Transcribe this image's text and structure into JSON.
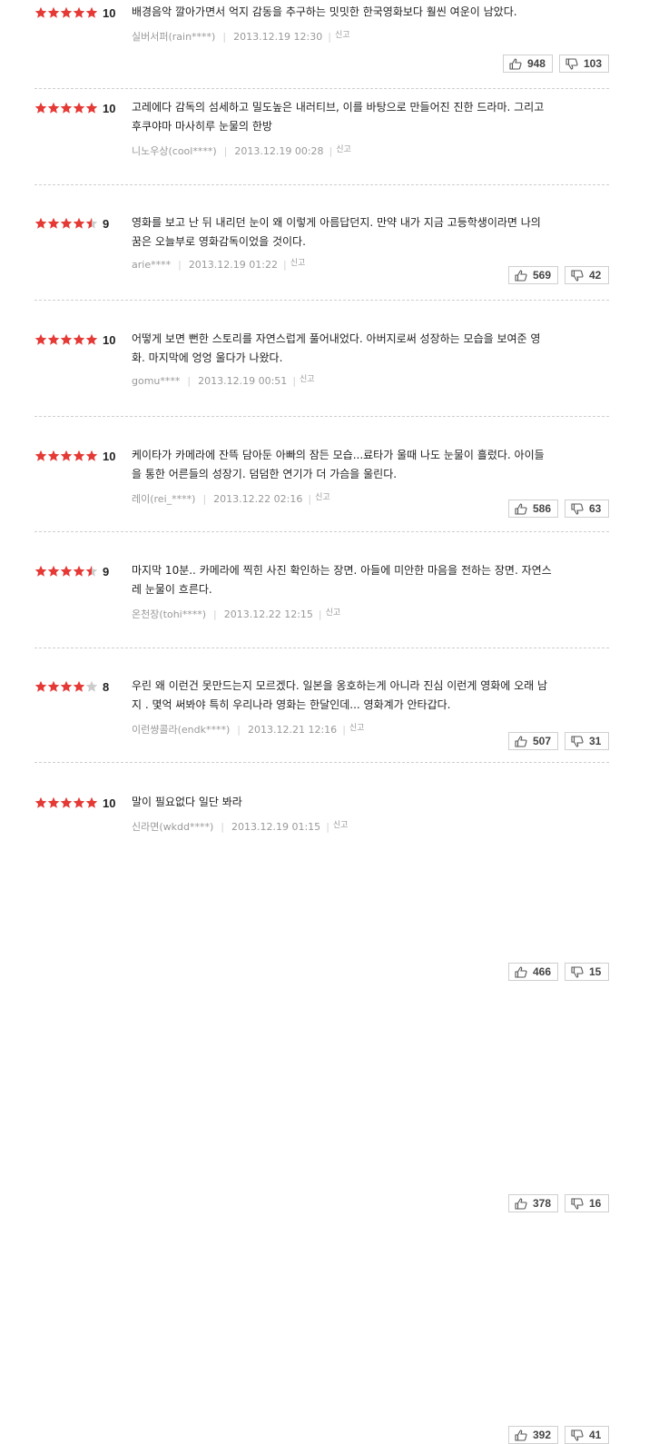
{
  "reviews": [
    {
      "stars": 5,
      "score": "10",
      "lines": [
        "배경음악 깔아가면서 억지 감동을 추구하는 밋밋한 한국영화보다 훨씬 여운이 남았다."
      ],
      "user": "실버서퍼(rain****)",
      "date": "2013.12.19 12:30",
      "report": "신고",
      "likes": "948",
      "dislikes": "103"
    },
    {
      "stars": 5,
      "score": "10",
      "lines": [
        "고레에다 감독의 섬세하고 밀도높은 내러티브, 이를 바탕으로 만들어진 진한 드라마. 그리고",
        "후쿠야마 마사히루 눈물의 한방"
      ],
      "user": "니노우상(cool****)",
      "date": "2013.12.19 00:28",
      "report": "신고",
      "likes": "569",
      "dislikes": "42"
    },
    {
      "stars": 4.5,
      "score": "9",
      "lines": [
        "영화를 보고 난 뒤 내리던 눈이 왜 이렇게 아름답던지. 만약 내가 지금 고등학생이라면 나의",
        "꿈은 오늘부로 영화감독이었을 것이다."
      ],
      "user": "arie****",
      "date": "2013.12.19 01:22",
      "report": "신고",
      "likes": "586",
      "dislikes": "63"
    },
    {
      "stars": 5,
      "score": "10",
      "lines": [
        "어떻게 보면 뻔한 스토리를 자연스럽게 풀어내었다. 아버지로써 성장하는 모습을 보여준 영",
        "화. 마지막에 엉엉 울다가 나왔다."
      ],
      "user": "gomu****",
      "date": "2013.12.19 00:51",
      "report": "신고",
      "likes": "507",
      "dislikes": "31"
    },
    {
      "stars": 5,
      "score": "10",
      "lines": [
        "케이타가 카메라에 잔뜩 담아둔 아빠의 잠든 모습...료타가 울때 나도 눈물이 흘렀다. 아이들",
        "을 통한 어른들의 성장기. 덤덤한 연기가 더 가슴을 울린다."
      ],
      "user": "레이(rei_****)",
      "date": "2013.12.22 02:16",
      "report": "신고",
      "likes": "466",
      "dislikes": "15"
    },
    {
      "stars": 4.5,
      "score": "9",
      "lines": [
        "마지막 10분.. 카메라에 찍힌 사진 확인하는 장면. 아들에 미안한 마음을 전하는 장면. 자연스",
        "레 눈물이 흐른다."
      ],
      "user": "온천장(tohi****)",
      "date": "2013.12.22 12:15",
      "report": "신고",
      "likes": "378",
      "dislikes": "16"
    },
    {
      "stars": 4,
      "score": "8",
      "lines": [
        "우린 왜 이런건 못만드는지 모르겠다. 일본을 옹호하는게 아니라 진심 이런게 영화에 오래 남",
        "지 . 몇억 써봐야 특히 우리나라 영화는 한달인데... 영화계가 안타갑다."
      ],
      "user": "이런썅콜라(endk****)",
      "date": "2013.12.21 12:16",
      "report": "신고",
      "likes": "392",
      "dislikes": "41"
    },
    {
      "stars": 5,
      "score": "10",
      "lines": [
        "말이 필요없다 일단 봐라"
      ],
      "user": "신라면(wkdd****)",
      "date": "2013.12.19 01:15",
      "report": "신고",
      "likes": "",
      "dislikes": ""
    }
  ],
  "colors": {
    "star_on": "#e53935",
    "star_off": "#cccccc"
  }
}
